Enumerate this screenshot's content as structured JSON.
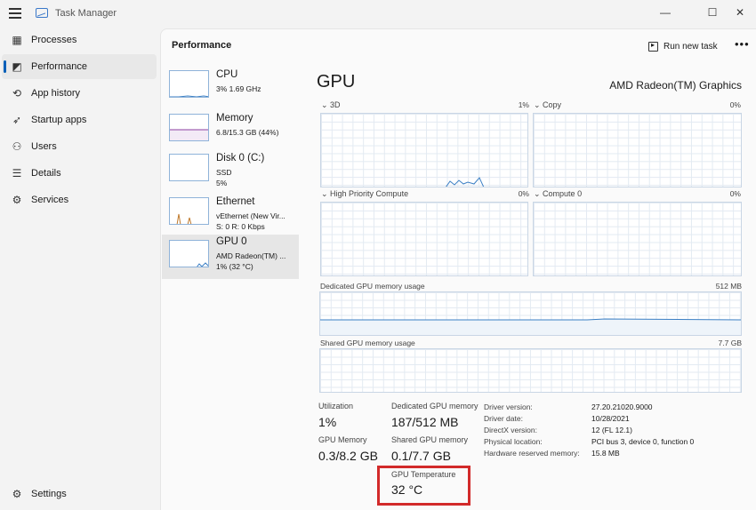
{
  "window": {
    "title": "Task Manager",
    "minimize_glyph": "—",
    "maximize_glyph": "☐",
    "close_glyph": "✕"
  },
  "sidebar": {
    "items": [
      {
        "label": "Processes",
        "icon": "processes-icon",
        "glyph": "▦"
      },
      {
        "label": "Performance",
        "icon": "performance-icon",
        "glyph": "◩"
      },
      {
        "label": "App history",
        "icon": "history-icon",
        "glyph": "⟲"
      },
      {
        "label": "Startup apps",
        "icon": "startup-icon",
        "glyph": "➶"
      },
      {
        "label": "Users",
        "icon": "users-icon",
        "glyph": "⚇"
      },
      {
        "label": "Details",
        "icon": "details-icon",
        "glyph": "☰"
      },
      {
        "label": "Services",
        "icon": "services-icon",
        "glyph": "⚙"
      }
    ],
    "settings": {
      "label": "Settings",
      "glyph": "⚙"
    }
  },
  "header": {
    "title": "Performance",
    "run_task": "Run new task",
    "more": "•••"
  },
  "devices": [
    {
      "name": "CPU",
      "sub1": "3% 1.69 GHz",
      "sub2": ""
    },
    {
      "name": "Memory",
      "sub1": "6.8/15.3 GB (44%)",
      "sub2": ""
    },
    {
      "name": "Disk 0 (C:)",
      "sub1": "SSD",
      "sub2": "5%"
    },
    {
      "name": "Ethernet",
      "sub1": "vEthernet (New Vir...",
      "sub2": "S: 0 R: 0 Kbps"
    },
    {
      "name": "GPU 0",
      "sub1": "AMD Radeon(TM) ...",
      "sub2": "1% (32 °C)"
    }
  ],
  "gpu": {
    "title": "GPU",
    "model": "AMD Radeon(TM) Graphics",
    "engines": [
      {
        "label": "3D",
        "pct": "1%"
      },
      {
        "label": "Copy",
        "pct": "0%"
      },
      {
        "label": "High Priority Compute",
        "pct": "0%"
      },
      {
        "label": "Compute 0",
        "pct": "0%"
      }
    ],
    "dedicated_mem_label": "Dedicated GPU memory usage",
    "dedicated_mem_max": "512 MB",
    "shared_mem_label": "Shared GPU memory usage",
    "shared_mem_max": "7.7 GB",
    "stats": {
      "utilization_label": "Utilization",
      "utilization": "1%",
      "dedicated_label": "Dedicated GPU memory",
      "dedicated": "187/512 MB",
      "gpu_mem_label": "GPU Memory",
      "gpu_mem": "0.3/8.2 GB",
      "shared_label": "Shared GPU memory",
      "shared": "0.1/7.7 GB",
      "temp_label": "GPU Temperature",
      "temp": "32 °C"
    },
    "details": [
      {
        "key": "Driver version:",
        "value": "27.20.21020.9000"
      },
      {
        "key": "Driver date:",
        "value": "10/28/2021"
      },
      {
        "key": "DirectX version:",
        "value": "12 (FL 12.1)"
      },
      {
        "key": "Physical location:",
        "value": "PCI bus 3, device 0, function 0"
      },
      {
        "key": "Hardware reserved memory:",
        "value": "15.8 MB"
      }
    ]
  },
  "colors": {
    "accent": "#005fb8",
    "graph_line": "#3b7fc4",
    "highlight": "#d22a2a",
    "memory_line": "#8b3fa0",
    "ethernet_line": "#c07a2c"
  }
}
